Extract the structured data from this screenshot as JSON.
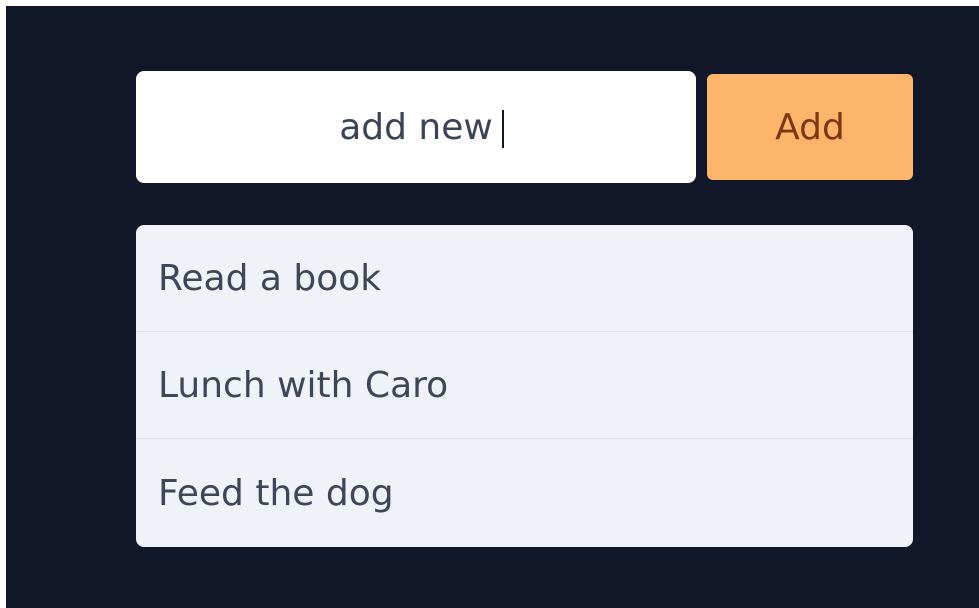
{
  "new_task": {
    "value": "add new",
    "button_label": "Add"
  },
  "tasks": [
    {
      "label": "Read a book"
    },
    {
      "label": "Lunch with Caro"
    },
    {
      "label": "Feed the dog"
    }
  ],
  "colors": {
    "background": "#111729",
    "input_background": "#ffffff",
    "button_background": "#fdb56c",
    "button_text": "#7c3815",
    "list_background": "#eff2f7",
    "list_text": "#3e4658"
  }
}
